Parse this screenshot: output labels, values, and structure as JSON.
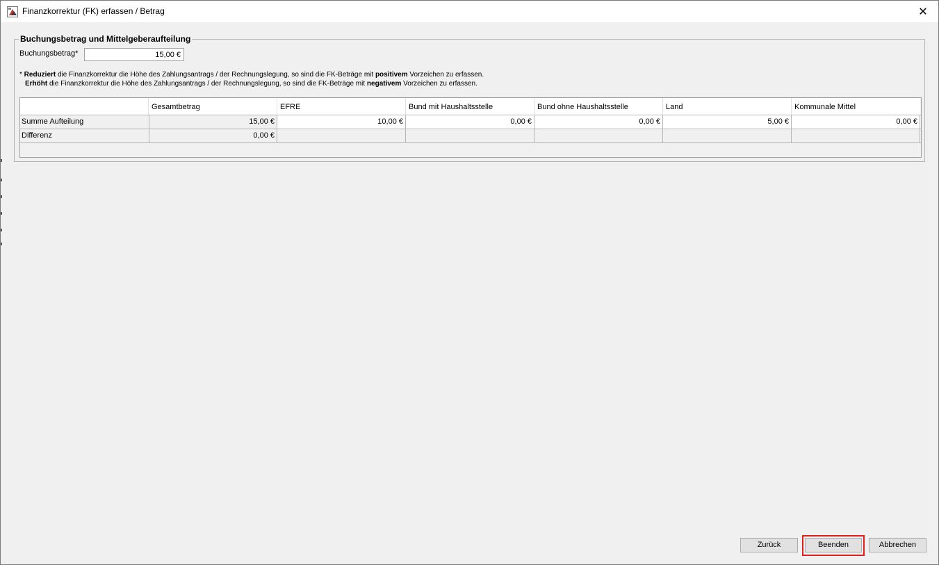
{
  "window": {
    "title": "Finanzkorrektur (FK) erfassen / Betrag",
    "close_glyph": "✕"
  },
  "group": {
    "title": "Buchungsbetrag und Mittelgeberaufteilung"
  },
  "buchungsbetrag": {
    "label": "Buchungsbetrag*",
    "value": "15,00 €"
  },
  "notes": {
    "line1": {
      "prefix": "* ",
      "bold1": "Reduziert",
      "text1": " die Finanzkorrektur die Höhe des Zahlungsantrags / der Rechnungslegung, so sind die FK-Beträge mit ",
      "bold2": "positivem",
      "text2": " Vorzeichen zu erfassen."
    },
    "line2": {
      "bold1": "Erhöht",
      "text1": " die Finanzkorrektur die Höhe des Zahlungsantrags / der Rechnungslegung, so sind die FK-Beträge mit ",
      "bold2": "negativem",
      "text2": " Vorzeichen zu erfassen."
    }
  },
  "table": {
    "columns": [
      "",
      "Gesamtbetrag",
      "EFRE",
      "Bund mit Haushaltsstelle",
      "Bund ohne Haushaltsstelle",
      "Land",
      "Kommunale Mittel"
    ],
    "rows": [
      {
        "label": "Summe Aufteilung",
        "cells": [
          "15,00 €",
          "10,00 €",
          "0,00 €",
          "0,00 €",
          "5,00 €",
          "0,00 €"
        ]
      },
      {
        "label": "Differenz",
        "cells": [
          "0,00 €",
          "",
          "",
          "",
          "",
          ""
        ]
      }
    ]
  },
  "buttons": {
    "back": "Zurück",
    "finish": "Beenden",
    "cancel": "Abbrechen"
  },
  "colors": {
    "highlight": "#e02020",
    "window_bg": "#f0f0f0",
    "button_bg": "#e1e1e1"
  },
  "icons": {
    "app": "app-logo-icon",
    "close": "close-icon"
  }
}
